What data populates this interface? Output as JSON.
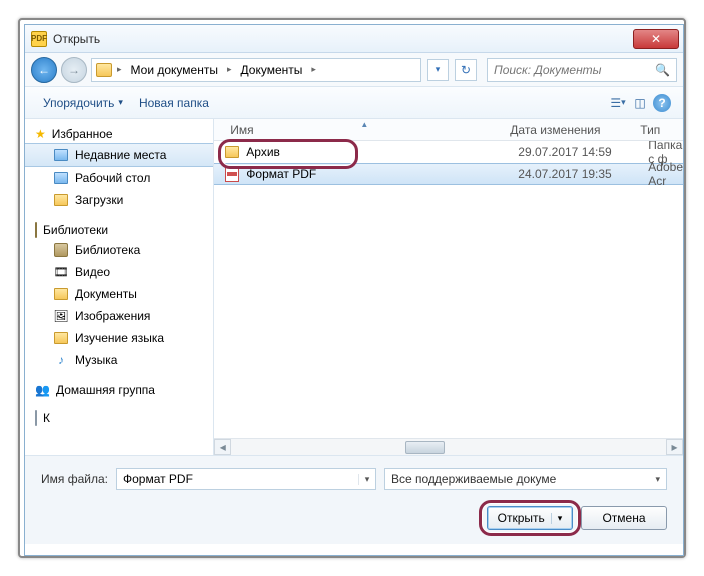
{
  "window": {
    "title": "Открыть"
  },
  "nav": {
    "breadcrumb": [
      "Мои документы",
      "Документы"
    ],
    "search_placeholder": "Поиск: Документы"
  },
  "toolbar": {
    "organize": "Упорядочить",
    "new_folder": "Новая папка"
  },
  "sidebar": {
    "favorites": {
      "label": "Избранное",
      "items": [
        {
          "label": "Недавние места",
          "selected": true,
          "icon": "recent"
        },
        {
          "label": "Рабочий стол",
          "icon": "desktop"
        },
        {
          "label": "Загрузки",
          "icon": "downloads"
        }
      ]
    },
    "libraries": {
      "label": "Библиотеки",
      "items": [
        {
          "label": "Библиотека",
          "icon": "lib"
        },
        {
          "label": "Видео",
          "icon": "video"
        },
        {
          "label": "Документы",
          "icon": "docs"
        },
        {
          "label": "Изображения",
          "icon": "images"
        },
        {
          "label": "Изучение языка",
          "icon": "lang"
        },
        {
          "label": "Музыка",
          "icon": "music"
        }
      ]
    },
    "homegroup": {
      "label": "Домашняя группа"
    },
    "computer": {
      "label": "К"
    }
  },
  "filelist": {
    "columns": {
      "name": "Имя",
      "date": "Дата изменения",
      "type": "Тип"
    },
    "rows": [
      {
        "name": "Архив",
        "date": "29.07.2017 14:59",
        "type": "Папка с ф",
        "kind": "folder",
        "selected": false
      },
      {
        "name": "Формат PDF",
        "date": "24.07.2017 19:35",
        "type": "Adobe Acr",
        "kind": "pdf",
        "selected": true
      }
    ]
  },
  "footer": {
    "filename_label": "Имя файла:",
    "filename_value": "Формат PDF",
    "filter": "Все поддерживаемые докуме",
    "open": "Открыть",
    "cancel": "Отмена"
  }
}
